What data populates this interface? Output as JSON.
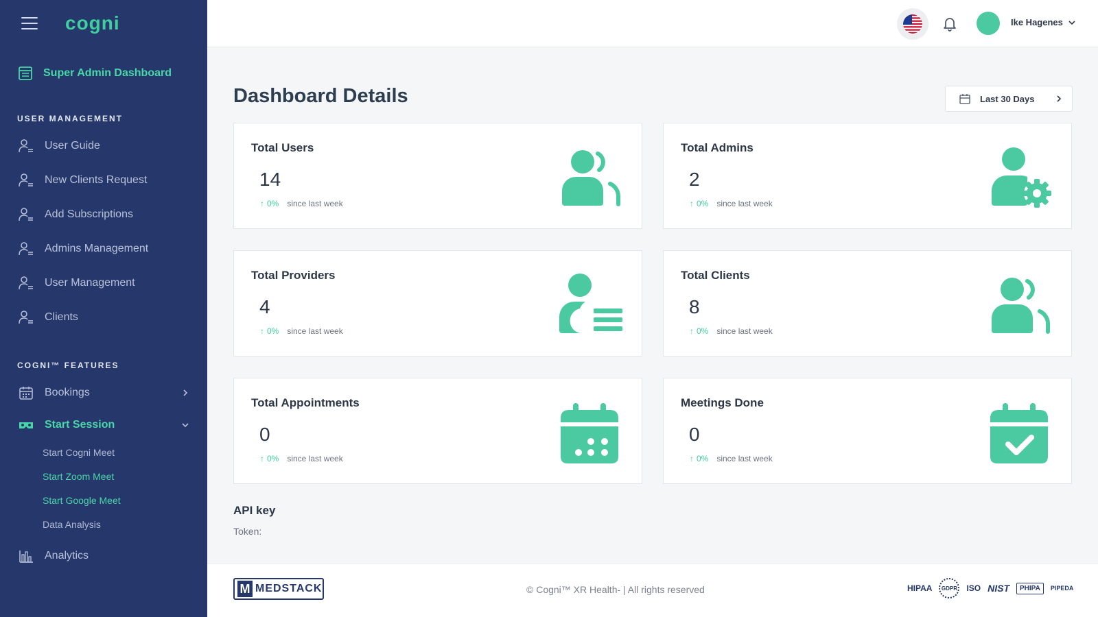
{
  "sidebar": {
    "logo": "cogni",
    "dashboard_label": "Super Admin Dashboard",
    "sections": {
      "user_management": "USER MANAGEMENT",
      "features": "COGNI™ FEATURES"
    },
    "user_items": [
      {
        "label": "User Guide"
      },
      {
        "label": "New Clients Request"
      },
      {
        "label": "Add Subscriptions"
      },
      {
        "label": "Admins Management"
      },
      {
        "label": "User Management"
      },
      {
        "label": "Clients"
      }
    ],
    "bookings_label": "Bookings",
    "start_session_label": "Start Session",
    "sub_items": [
      {
        "label": "Start Cogni Meet"
      },
      {
        "label": "Start Zoom Meet"
      },
      {
        "label": "Start Google Meet"
      },
      {
        "label": "Data Analysis"
      }
    ],
    "analytics_label": "Analytics"
  },
  "header": {
    "user_name": "Ike Hagenes"
  },
  "main": {
    "title": "Dashboard Details",
    "range_label": "Last 30 Days",
    "cards": [
      {
        "title": "Total Users",
        "value": "14",
        "change": "0%",
        "since": "since last week",
        "icon": "users-icon"
      },
      {
        "title": "Total Admins",
        "value": "2",
        "change": "0%",
        "since": "since last week",
        "icon": "admin-gear-icon"
      },
      {
        "title": "Total Providers",
        "value": "4",
        "change": "0%",
        "since": "since last week",
        "icon": "provider-list-icon"
      },
      {
        "title": "Total Clients",
        "value": "8",
        "change": "0%",
        "since": "since last week",
        "icon": "clients-icon"
      },
      {
        "title": "Total Appointments",
        "value": "0",
        "change": "0%",
        "since": "since last week",
        "icon": "calendar-icon"
      },
      {
        "title": "Meetings Done",
        "value": "0",
        "change": "0%",
        "since": "since last week",
        "icon": "calendar-check-icon"
      }
    ],
    "api_heading": "API key",
    "token_label": "Token:"
  },
  "footer": {
    "medstack": "MEDSTACK",
    "copyright": "© Cogni™ XR Health- | All rights reserved",
    "badges": [
      "HIPAA",
      "GDPR",
      "ISO",
      "NIST",
      "PHIPA",
      "PIPEDA"
    ]
  },
  "colors": {
    "sidebar_bg": "#26386b",
    "accent": "#4ad7a7",
    "icon_green": "#4bc9a1"
  }
}
